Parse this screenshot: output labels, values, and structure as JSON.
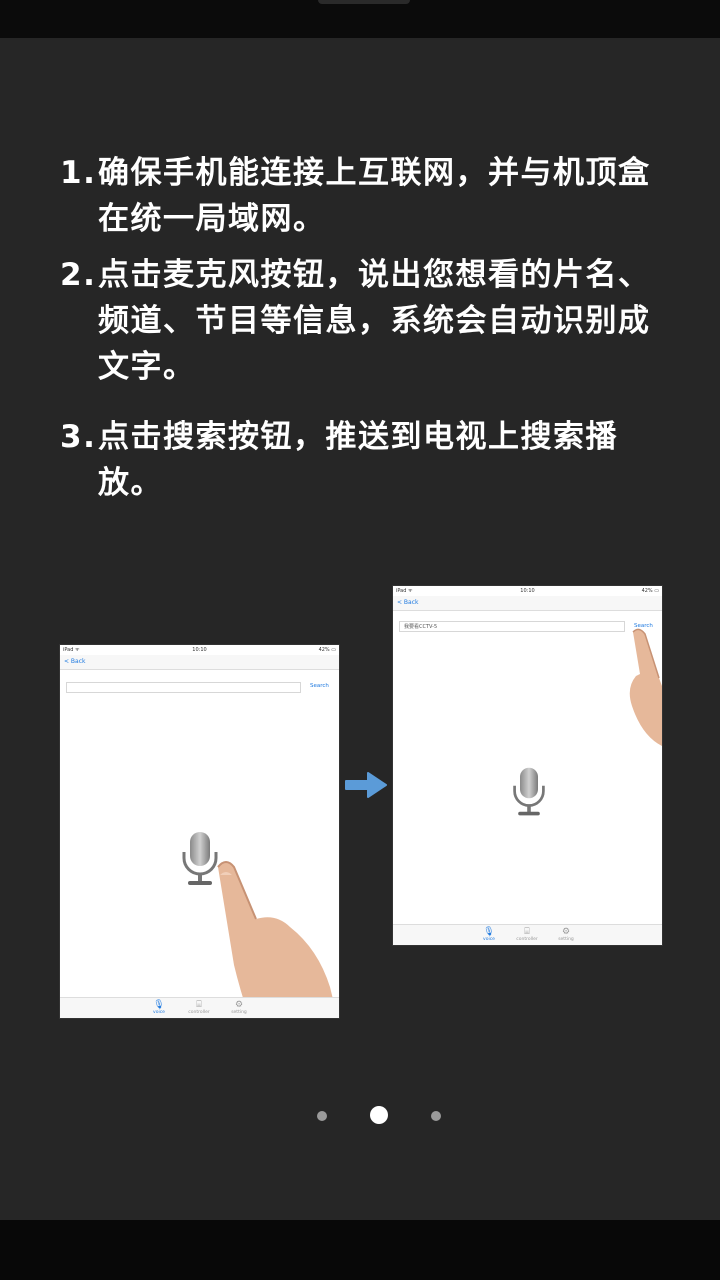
{
  "steps": [
    {
      "num": "1.",
      "text": "确保手机能连接上互联网，并与机顶盒在统一局域网。"
    },
    {
      "num": "2.",
      "text": "点击麦克风按钮，说出您想看的片名、频道、节目等信息，系统会自动识别成文字。"
    },
    {
      "num": "3.",
      "text": "点击搜索按钮，推送到电视上搜索播放。"
    }
  ],
  "left_device": {
    "status_left": "iPad ᯤ",
    "status_center": "10:10",
    "status_right": "42% ▭",
    "back_label": "< Back",
    "search_value": "",
    "search_button": "Search",
    "tabs": [
      {
        "icon": "mic-icon",
        "label": "voice",
        "active": true
      },
      {
        "icon": "controller-icon",
        "label": "controller",
        "active": false
      },
      {
        "icon": "gear-icon",
        "label": "setting",
        "active": false
      }
    ]
  },
  "right_device": {
    "status_left": "iPad ᯤ",
    "status_center": "10:10",
    "status_right": "42% ▭",
    "back_label": "< Back",
    "search_value": "我要看CCTV-5",
    "search_button": "Search",
    "tabs": [
      {
        "icon": "mic-icon",
        "label": "voice",
        "active": true
      },
      {
        "icon": "controller-icon",
        "label": "controller",
        "active": false
      },
      {
        "icon": "gear-icon",
        "label": "setting",
        "active": false
      }
    ]
  },
  "pager": {
    "pages": 3,
    "current": 2
  },
  "colors": {
    "background": "#262626",
    "accent": "#1f7ae0",
    "arrow": "#5b9bd8"
  }
}
